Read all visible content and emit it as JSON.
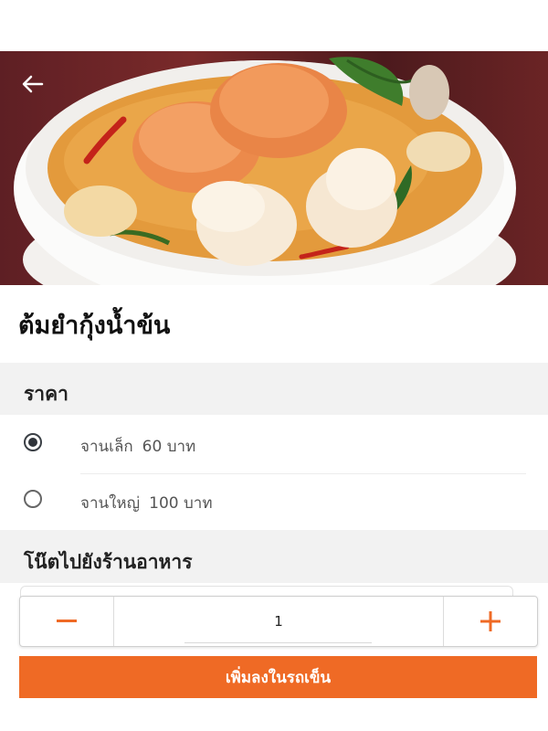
{
  "dish": {
    "image_alt": "ต้มยำกุ้งน้ำข้น",
    "name": "ต้มยำกุ้งน้ำข้น"
  },
  "price_section": {
    "title": "ราคา",
    "options": [
      {
        "size": "จานเล็ก",
        "price": "60 บาท",
        "selected": true
      },
      {
        "size": "จานใหญ่",
        "price": "100 บาท",
        "selected": false
      }
    ]
  },
  "note_section": {
    "title": "โน๊ตไปยังร้านอาหาร"
  },
  "quantity": {
    "value": "1",
    "minus_icon": "minus-icon",
    "plus_icon": "plus-icon"
  },
  "cart": {
    "add_label": "เพิ่มลงในรถเข็น"
  },
  "icons": {
    "back": "arrow-left-icon"
  },
  "colors": {
    "accent": "#ef6a25",
    "section_bg": "#f2f2f2",
    "radio_selected": "#2f343a"
  }
}
